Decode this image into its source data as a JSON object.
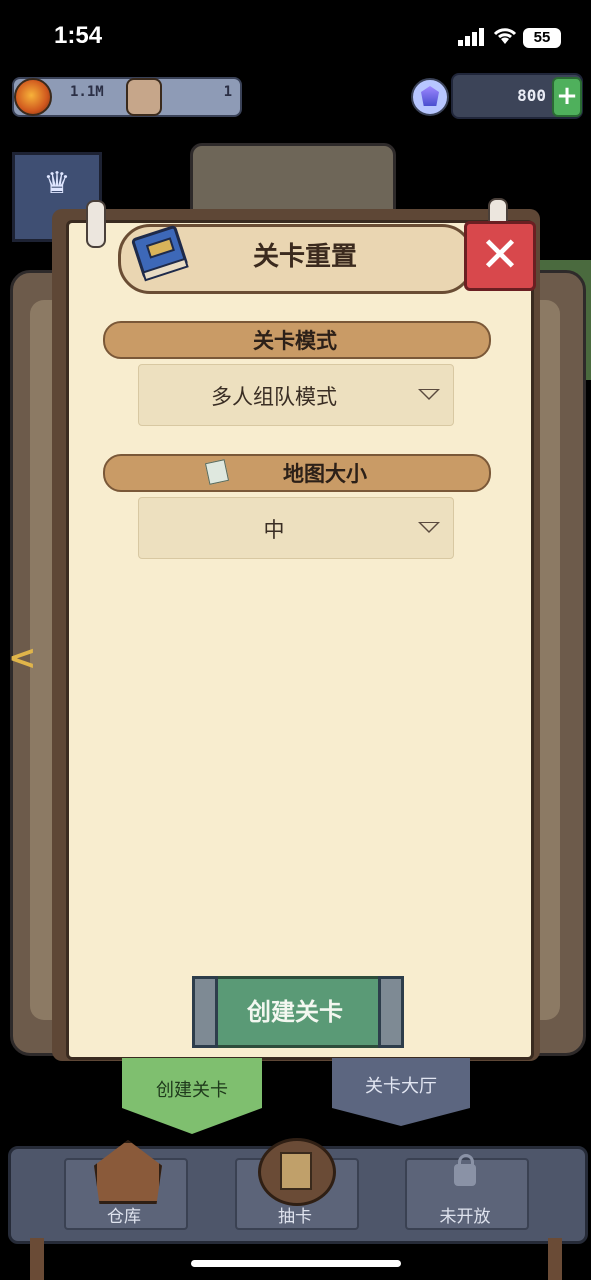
{
  "status_bar": {
    "time": "1:54",
    "battery": "55"
  },
  "resources": {
    "coins": "1.1M",
    "population": "1",
    "gems": "800"
  },
  "dialog": {
    "title": "关卡重置",
    "sections": [
      {
        "label": "关卡模式",
        "value": "多人组队模式"
      },
      {
        "label": "地图大小",
        "value": "中"
      }
    ],
    "create_button": "创建关卡"
  },
  "tabs": [
    {
      "label": "创建关卡",
      "active": true
    },
    {
      "label": "关卡大厅",
      "active": false
    }
  ],
  "nav": [
    {
      "label": "仓库",
      "icon": "warehouse-icon"
    },
    {
      "label": "抽卡",
      "icon": "card-draw-icon"
    },
    {
      "label": "未开放",
      "icon": "lock-icon"
    }
  ],
  "colors": {
    "close_red": "#d8484c",
    "create_green": "#5a9a76",
    "tab_active_green": "#7fbf6f",
    "dialog_bg": "#f8edcf"
  }
}
